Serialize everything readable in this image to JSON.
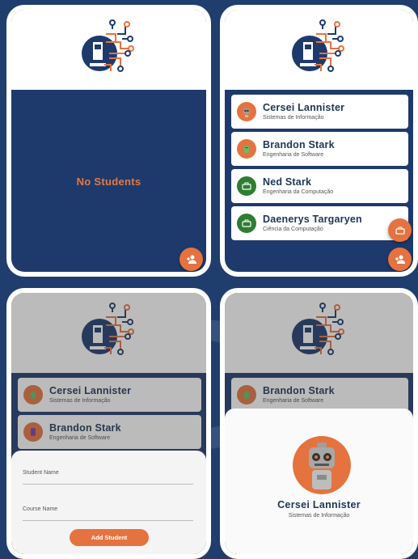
{
  "colors": {
    "background": "#1f3e6e",
    "primary": "#1e3a6d",
    "accent": "#e5733f",
    "green": "#2e7d32"
  },
  "screen_empty": {
    "empty_message": "No Students",
    "fab_icon": "add-person-icon"
  },
  "screen_list": {
    "students": [
      {
        "name": "Cersei Lannister",
        "course": "Sistemas de Informação",
        "avatar": "robot-avatar"
      },
      {
        "name": "Brandon Stark",
        "course": "Engenharia de Software",
        "avatar": "android-avatar"
      },
      {
        "name": "Ned Stark",
        "course": "Engenharia da Computação",
        "avatar": "briefcase-avatar"
      },
      {
        "name": "Daenerys Targaryen",
        "course": "Ciência da Computação",
        "avatar": "briefcase-avatar"
      }
    ],
    "fab_secondary_icon": "briefcase-icon",
    "fab_primary_icon": "add-person-icon"
  },
  "screen_form": {
    "students": [
      {
        "name": "Cersei Lannister",
        "course": "Sistemas de Informação"
      },
      {
        "name": "Brandon Stark",
        "course": "Engenharia de Software"
      }
    ],
    "student_name_placeholder": "Student Name",
    "course_name_placeholder": "Course Name",
    "submit_label": "Add Student"
  },
  "screen_detail": {
    "background_student": {
      "name": "Brandon Stark",
      "course": "Engenharia de Software"
    },
    "name": "Cersei Lannister",
    "course": "Sistemas de Informação"
  }
}
